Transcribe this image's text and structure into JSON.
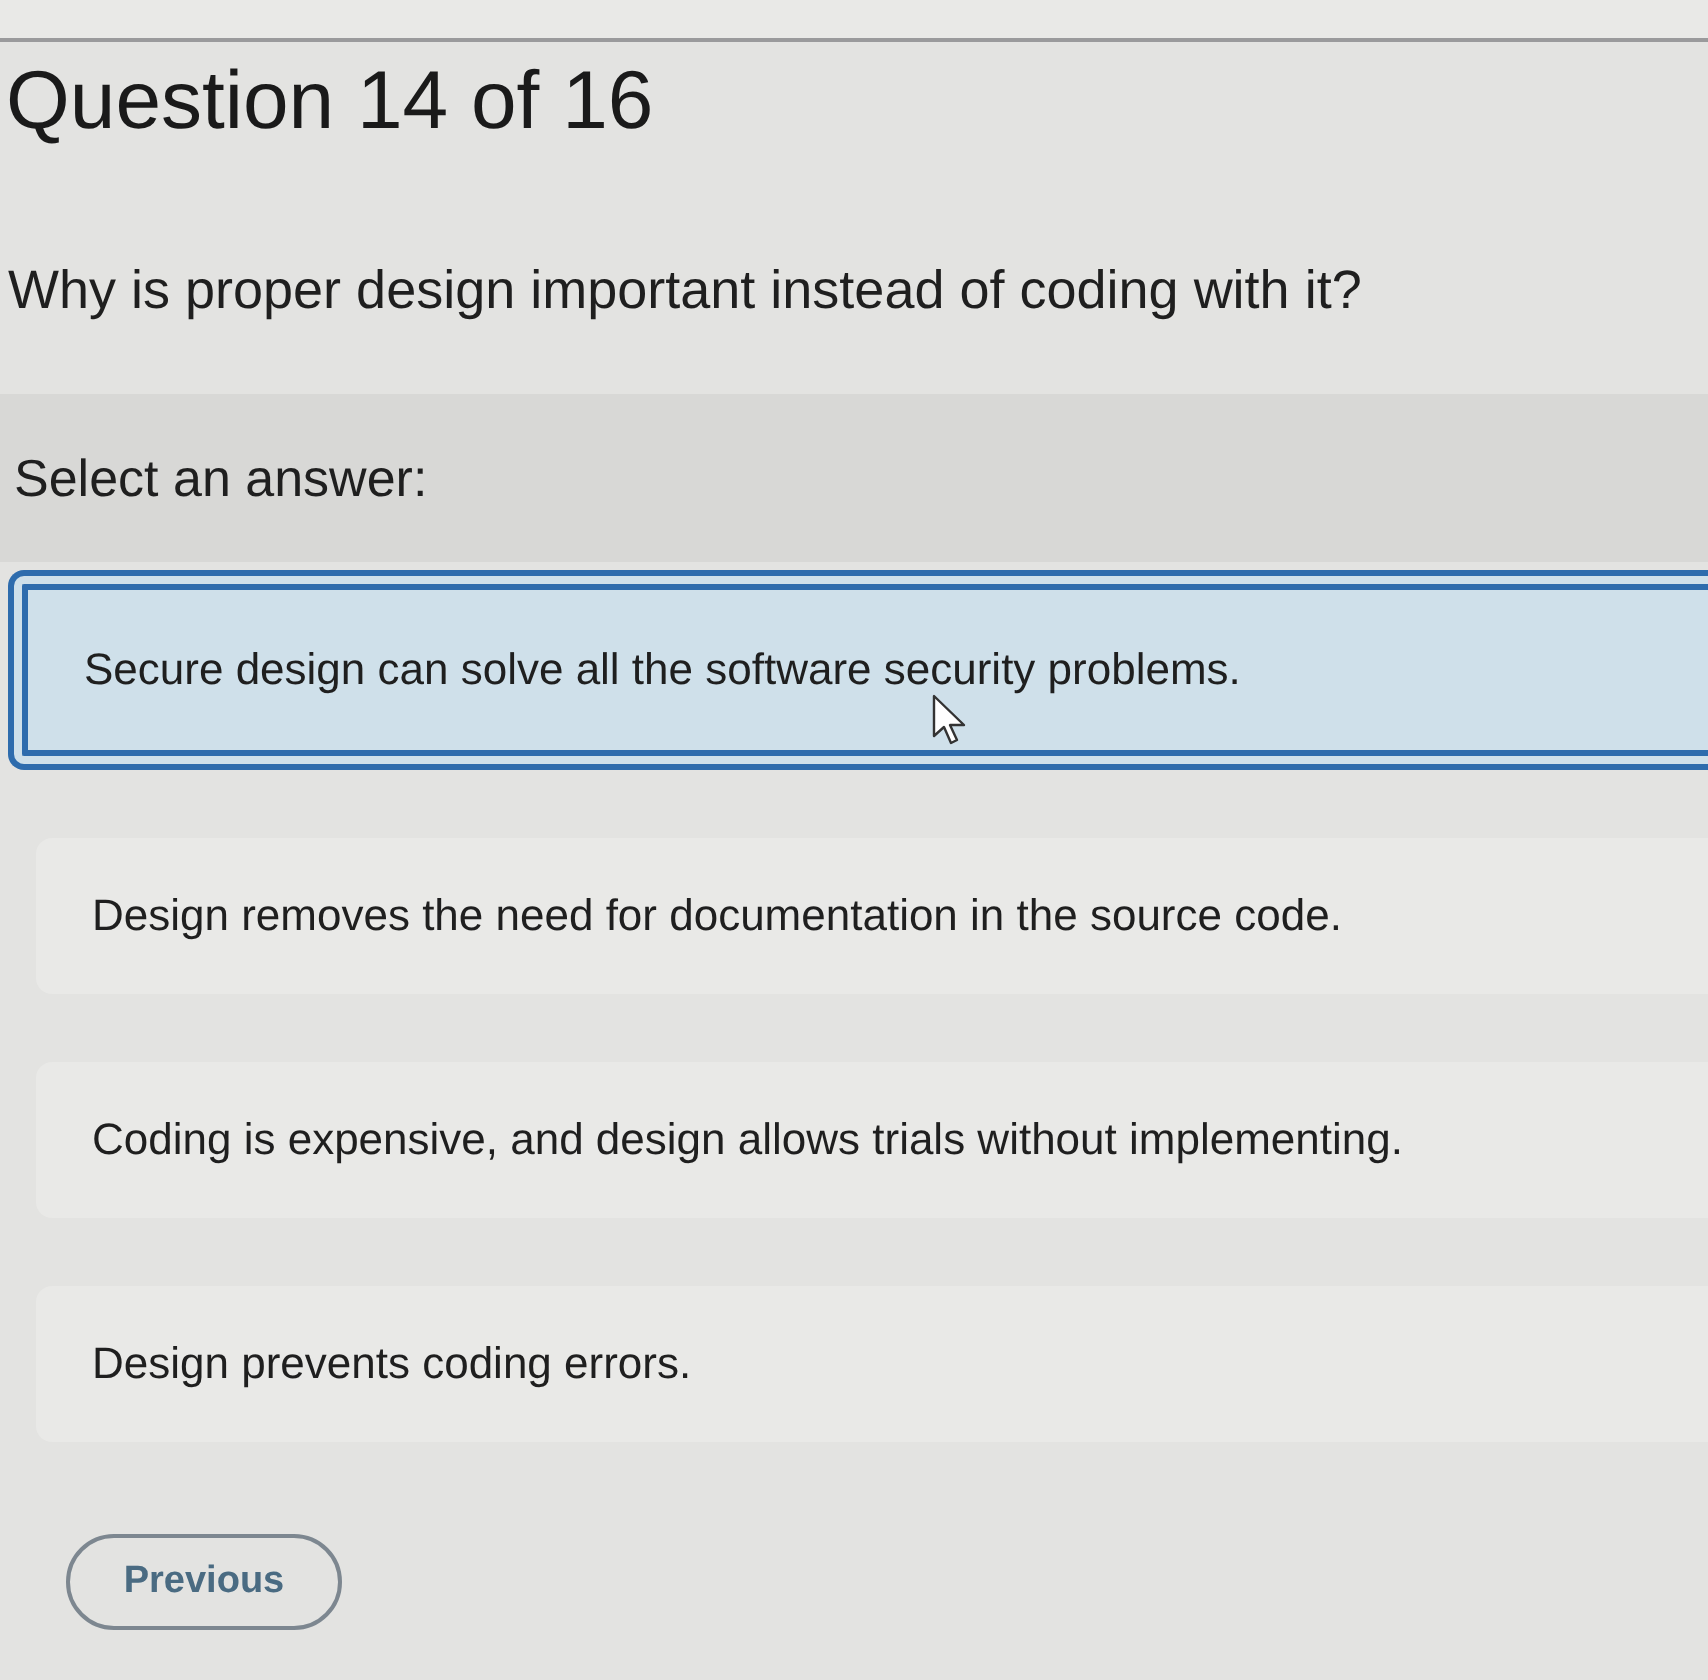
{
  "header": {
    "title": "Question 14 of 16"
  },
  "question": {
    "text": "Why is proper design important instead of coding with it?"
  },
  "answers": {
    "prompt": "Select an answer:",
    "options": [
      {
        "text": "Secure design can solve all the software security problems.",
        "selected": true
      },
      {
        "text": "Design removes the need for documentation in the source code.",
        "selected": false
      },
      {
        "text": "Coding is expensive, and design allows trials without implementing.",
        "selected": false
      },
      {
        "text": "Design prevents coding errors.",
        "selected": false
      }
    ]
  },
  "navigation": {
    "previous": "Previous"
  }
}
